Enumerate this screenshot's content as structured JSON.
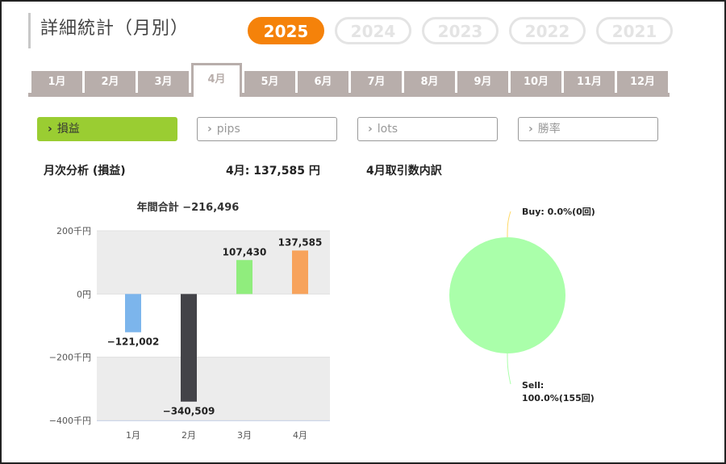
{
  "page": {
    "title": "詳細統計（月別）"
  },
  "years": [
    {
      "label": "2025",
      "active": true
    },
    {
      "label": "2024",
      "active": false
    },
    {
      "label": "2023",
      "active": false
    },
    {
      "label": "2022",
      "active": false
    },
    {
      "label": "2021",
      "active": false
    }
  ],
  "months": [
    {
      "label": "1月",
      "active": false
    },
    {
      "label": "2月",
      "active": false
    },
    {
      "label": "3月",
      "active": false
    },
    {
      "label": "4月",
      "active": true
    },
    {
      "label": "5月",
      "active": false
    },
    {
      "label": "6月",
      "active": false
    },
    {
      "label": "7月",
      "active": false
    },
    {
      "label": "8月",
      "active": false
    },
    {
      "label": "9月",
      "active": false
    },
    {
      "label": "10月",
      "active": false
    },
    {
      "label": "11月",
      "active": false
    },
    {
      "label": "12月",
      "active": false
    }
  ],
  "metrics": [
    {
      "label": "損益",
      "active": true
    },
    {
      "label": "pips",
      "active": false
    },
    {
      "label": "lots",
      "active": false
    },
    {
      "label": "勝率",
      "active": false
    }
  ],
  "summary": {
    "section_label": "月次分析 (損益)",
    "month_value": "4月:  137,585 円",
    "breakdown_label": "4月取引数内訳"
  },
  "colors": {
    "accent": "#f5820a",
    "metric_active": "#9acd32",
    "tab": "#b8aeab"
  },
  "chart_data": [
    {
      "type": "bar",
      "title": "年間合計 −216,496",
      "categories": [
        "1月",
        "2月",
        "3月",
        "4月"
      ],
      "values": [
        -121002,
        -340509,
        107430,
        137585
      ],
      "value_labels": [
        "−121,002",
        "−340,509",
        "107,430",
        "137,585"
      ],
      "colors": [
        "#7cb5ec",
        "#434348",
        "#90ed7d",
        "#f7a35c"
      ],
      "ylim": [
        -400000,
        200000
      ],
      "yticks": [
        200000,
        0,
        -200000,
        -400000
      ],
      "ytick_labels": [
        "200千円",
        "0円",
        "−200千円",
        "−400千円"
      ],
      "grid": true
    },
    {
      "type": "pie",
      "slices": [
        {
          "name": "Buy",
          "label_line1": "Buy: 0.0%(0回)",
          "percent": 0.0,
          "count": 0,
          "color": "#ffd966"
        },
        {
          "name": "Sell",
          "label_line1": "Sell:",
          "label_line2": "100.0%(155回)",
          "percent": 100.0,
          "count": 155,
          "color": "#aaffaa"
        }
      ]
    }
  ]
}
